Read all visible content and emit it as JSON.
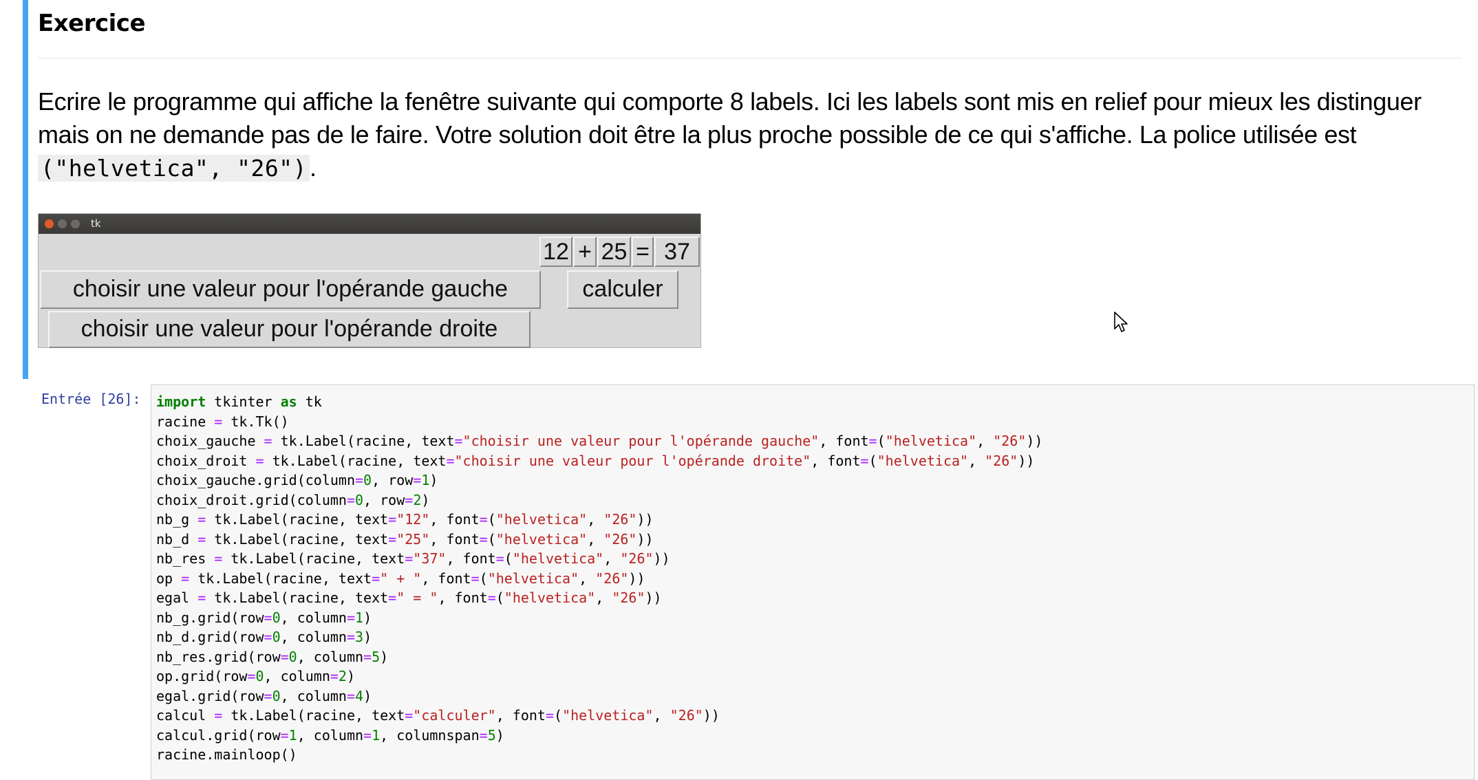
{
  "markdown": {
    "heading": "Exercice",
    "paragraph_before_code": "Ecrire le programme qui affiche la fenêtre suivante qui comporte 8 labels. Ici les labels sont mis en relief pour mieux les distinguer mais on ne demande pas de le faire. Votre solution doit être la plus proche possible de ce qui s'affiche. La police utilisée est ",
    "inline_code": "(\"helvetica\", \"26\")",
    "paragraph_after_code": "."
  },
  "tk_window": {
    "title": "tk",
    "label_nb_g": "12",
    "label_op": "+",
    "label_nb_d": "25",
    "label_egal": "=",
    "label_nb_res": "37",
    "label_choix_gauche": "choisir une valeur pour l'opérande gauche",
    "label_calcul": "calculer",
    "label_choix_droit": "choisir une valeur pour l'opérande droite"
  },
  "code_cell": {
    "prompt": "Entrée [26]:",
    "lines": [
      [
        {
          "t": "import",
          "c": "kw"
        },
        {
          "t": " tkinter "
        },
        {
          "t": "as",
          "c": "kw"
        },
        {
          "t": " tk"
        }
      ],
      [
        {
          "t": "racine "
        },
        {
          "t": "=",
          "c": "op"
        },
        {
          "t": " tk.Tk()"
        }
      ],
      [
        {
          "t": "choix_gauche "
        },
        {
          "t": "=",
          "c": "op"
        },
        {
          "t": " tk.Label(racine, text"
        },
        {
          "t": "=",
          "c": "op"
        },
        {
          "t": "\"choisir une valeur pour l'opérande gauche\"",
          "c": "str"
        },
        {
          "t": ", font"
        },
        {
          "t": "=",
          "c": "op"
        },
        {
          "t": "("
        },
        {
          "t": "\"helvetica\"",
          "c": "str"
        },
        {
          "t": ", "
        },
        {
          "t": "\"26\"",
          "c": "str"
        },
        {
          "t": "))"
        }
      ],
      [
        {
          "t": "choix_droit "
        },
        {
          "t": "=",
          "c": "op"
        },
        {
          "t": " tk.Label(racine, text"
        },
        {
          "t": "=",
          "c": "op"
        },
        {
          "t": "\"choisir une valeur pour l'opérande droite\"",
          "c": "str"
        },
        {
          "t": ", font"
        },
        {
          "t": "=",
          "c": "op"
        },
        {
          "t": "("
        },
        {
          "t": "\"helvetica\"",
          "c": "str"
        },
        {
          "t": ", "
        },
        {
          "t": "\"26\"",
          "c": "str"
        },
        {
          "t": "))"
        }
      ],
      [
        {
          "t": "choix_gauche.grid(column"
        },
        {
          "t": "=",
          "c": "op"
        },
        {
          "t": "0",
          "c": "num"
        },
        {
          "t": ", row"
        },
        {
          "t": "=",
          "c": "op"
        },
        {
          "t": "1",
          "c": "num"
        },
        {
          "t": ")"
        }
      ],
      [
        {
          "t": "choix_droit.grid(column"
        },
        {
          "t": "=",
          "c": "op"
        },
        {
          "t": "0",
          "c": "num"
        },
        {
          "t": ", row"
        },
        {
          "t": "=",
          "c": "op"
        },
        {
          "t": "2",
          "c": "num"
        },
        {
          "t": ")"
        }
      ],
      [
        {
          "t": "nb_g "
        },
        {
          "t": "=",
          "c": "op"
        },
        {
          "t": " tk.Label(racine, text"
        },
        {
          "t": "=",
          "c": "op"
        },
        {
          "t": "\"12\"",
          "c": "str"
        },
        {
          "t": ", font"
        },
        {
          "t": "=",
          "c": "op"
        },
        {
          "t": "("
        },
        {
          "t": "\"helvetica\"",
          "c": "str"
        },
        {
          "t": ", "
        },
        {
          "t": "\"26\"",
          "c": "str"
        },
        {
          "t": "))"
        }
      ],
      [
        {
          "t": "nb_d "
        },
        {
          "t": "=",
          "c": "op"
        },
        {
          "t": " tk.Label(racine, text"
        },
        {
          "t": "=",
          "c": "op"
        },
        {
          "t": "\"25\"",
          "c": "str"
        },
        {
          "t": ", font"
        },
        {
          "t": "=",
          "c": "op"
        },
        {
          "t": "("
        },
        {
          "t": "\"helvetica\"",
          "c": "str"
        },
        {
          "t": ", "
        },
        {
          "t": "\"26\"",
          "c": "str"
        },
        {
          "t": "))"
        }
      ],
      [
        {
          "t": "nb_res "
        },
        {
          "t": "=",
          "c": "op"
        },
        {
          "t": " tk.Label(racine, text"
        },
        {
          "t": "=",
          "c": "op"
        },
        {
          "t": "\"37\"",
          "c": "str"
        },
        {
          "t": ", font"
        },
        {
          "t": "=",
          "c": "op"
        },
        {
          "t": "("
        },
        {
          "t": "\"helvetica\"",
          "c": "str"
        },
        {
          "t": ", "
        },
        {
          "t": "\"26\"",
          "c": "str"
        },
        {
          "t": "))"
        }
      ],
      [
        {
          "t": "op "
        },
        {
          "t": "=",
          "c": "op"
        },
        {
          "t": " tk.Label(racine, text"
        },
        {
          "t": "=",
          "c": "op"
        },
        {
          "t": "\" + \"",
          "c": "str"
        },
        {
          "t": ", font"
        },
        {
          "t": "=",
          "c": "op"
        },
        {
          "t": "("
        },
        {
          "t": "\"helvetica\"",
          "c": "str"
        },
        {
          "t": ", "
        },
        {
          "t": "\"26\"",
          "c": "str"
        },
        {
          "t": "))"
        }
      ],
      [
        {
          "t": "egal "
        },
        {
          "t": "=",
          "c": "op"
        },
        {
          "t": " tk.Label(racine, text"
        },
        {
          "t": "=",
          "c": "op"
        },
        {
          "t": "\" = \"",
          "c": "str"
        },
        {
          "t": ", font"
        },
        {
          "t": "=",
          "c": "op"
        },
        {
          "t": "("
        },
        {
          "t": "\"helvetica\"",
          "c": "str"
        },
        {
          "t": ", "
        },
        {
          "t": "\"26\"",
          "c": "str"
        },
        {
          "t": "))"
        }
      ],
      [
        {
          "t": "nb_g.grid(row"
        },
        {
          "t": "=",
          "c": "op"
        },
        {
          "t": "0",
          "c": "num"
        },
        {
          "t": ", column"
        },
        {
          "t": "=",
          "c": "op"
        },
        {
          "t": "1",
          "c": "num"
        },
        {
          "t": ")"
        }
      ],
      [
        {
          "t": "nb_d.grid(row"
        },
        {
          "t": "=",
          "c": "op"
        },
        {
          "t": "0",
          "c": "num"
        },
        {
          "t": ", column"
        },
        {
          "t": "=",
          "c": "op"
        },
        {
          "t": "3",
          "c": "num"
        },
        {
          "t": ")"
        }
      ],
      [
        {
          "t": "nb_res.grid(row"
        },
        {
          "t": "=",
          "c": "op"
        },
        {
          "t": "0",
          "c": "num"
        },
        {
          "t": ", column"
        },
        {
          "t": "=",
          "c": "op"
        },
        {
          "t": "5",
          "c": "num"
        },
        {
          "t": ")"
        }
      ],
      [
        {
          "t": "op.grid(row"
        },
        {
          "t": "=",
          "c": "op"
        },
        {
          "t": "0",
          "c": "num"
        },
        {
          "t": ", column"
        },
        {
          "t": "=",
          "c": "op"
        },
        {
          "t": "2",
          "c": "num"
        },
        {
          "t": ")"
        }
      ],
      [
        {
          "t": "egal.grid(row"
        },
        {
          "t": "=",
          "c": "op"
        },
        {
          "t": "0",
          "c": "num"
        },
        {
          "t": ", column"
        },
        {
          "t": "=",
          "c": "op"
        },
        {
          "t": "4",
          "c": "num"
        },
        {
          "t": ")"
        }
      ],
      [
        {
          "t": "calcul "
        },
        {
          "t": "=",
          "c": "op"
        },
        {
          "t": " tk.Label(racine, text"
        },
        {
          "t": "=",
          "c": "op"
        },
        {
          "t": "\"calculer\"",
          "c": "str"
        },
        {
          "t": ", font"
        },
        {
          "t": "=",
          "c": "op"
        },
        {
          "t": "("
        },
        {
          "t": "\"helvetica\"",
          "c": "str"
        },
        {
          "t": ", "
        },
        {
          "t": "\"26\"",
          "c": "str"
        },
        {
          "t": "))"
        }
      ],
      [
        {
          "t": "calcul.grid(row"
        },
        {
          "t": "=",
          "c": "op"
        },
        {
          "t": "1",
          "c": "num"
        },
        {
          "t": ", column"
        },
        {
          "t": "=",
          "c": "op"
        },
        {
          "t": "1",
          "c": "num"
        },
        {
          "t": ", columnspan"
        },
        {
          "t": "=",
          "c": "op"
        },
        {
          "t": "5",
          "c": "num"
        },
        {
          "t": ")"
        }
      ],
      [
        {
          "t": "racine.mainloop()"
        }
      ]
    ]
  },
  "colors": {
    "accent_bar": "#42a5f5",
    "prompt": "#303f9f",
    "keyword": "#008000",
    "string": "#ba2121",
    "number": "#008000",
    "operator": "#aa22ff"
  },
  "icons": [
    "mouse-cursor-icon",
    "close-icon",
    "minimize-icon",
    "maximize-icon"
  ]
}
